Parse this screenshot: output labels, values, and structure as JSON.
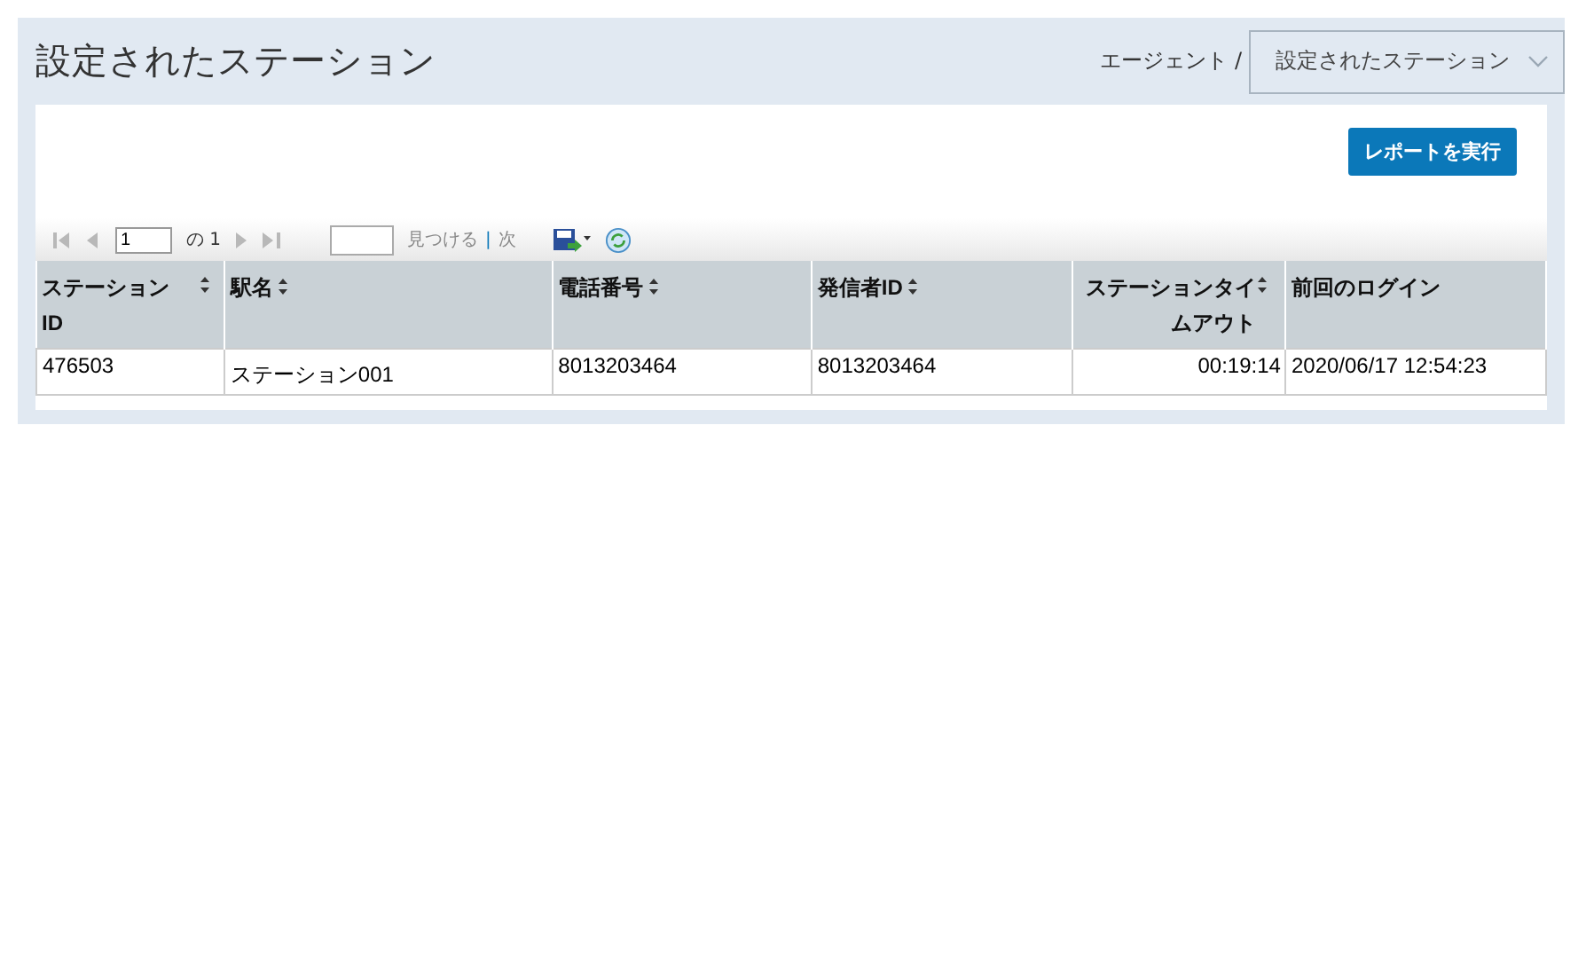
{
  "page": {
    "title": "設定されたステーション"
  },
  "breadcrumb": {
    "parent": "エージェント /",
    "current": "設定されたステーション"
  },
  "run_button": "レポートを実行",
  "toolbar": {
    "page_value": "1",
    "page_of": "の 1",
    "find_label": "見つける",
    "separator": "|",
    "next_label": "次",
    "first_disabled": true,
    "prev_disabled": true,
    "next_disabled": true,
    "last_disabled": true,
    "find_next_disabled": true
  },
  "table": {
    "columns": [
      {
        "label": "ステーションID",
        "sortable": true,
        "kind": "text"
      },
      {
        "label": "駅名",
        "sortable": true,
        "kind": "text"
      },
      {
        "label": "電話番号",
        "sortable": true,
        "kind": "text"
      },
      {
        "label": "発信者ID",
        "sortable": true,
        "kind": "text"
      },
      {
        "label": "ステーションタイムアウト",
        "sortable": true,
        "kind": "duration"
      },
      {
        "label": "前回のログイン",
        "sortable": false,
        "kind": "text"
      }
    ],
    "rows": [
      [
        "476503",
        "ステーション001",
        "8013203464",
        "8013203464",
        "00:19:14",
        "2020/06/17 12:54:23"
      ]
    ]
  }
}
